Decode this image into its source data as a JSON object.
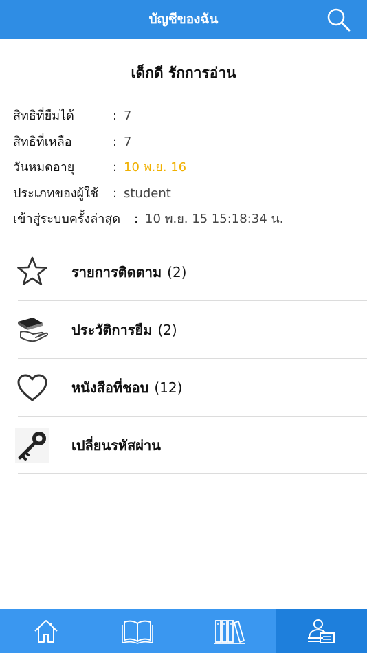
{
  "header": {
    "title": "บัญชีของฉัน",
    "search_icon": "search-icon"
  },
  "user": {
    "name": "เด็กดี รักการอ่าน"
  },
  "info": {
    "rows": [
      {
        "label": "สิทธิที่ยืมได้",
        "colon": ":",
        "value": "7"
      },
      {
        "label": "สิทธิที่เหลือ",
        "colon": ":",
        "value": "7"
      },
      {
        "label": "วันหมดอายุ",
        "colon": ":",
        "value": "10 พ.ย. 16"
      },
      {
        "label": "ประเภทของผู้ใช้",
        "colon": ":",
        "value": "student"
      },
      {
        "label": "เข้าสู่ระบบครั้งล่าสุด",
        "colon": ":",
        "value": "10 พ.ย. 15 15:18:34 น."
      }
    ],
    "expire_color": "#f0b000"
  },
  "menu": {
    "items": [
      {
        "label": "รายการติดตาม",
        "count": "(2)",
        "icon": "star-icon"
      },
      {
        "label": "ประวัติการยืม",
        "count": "(2)",
        "icon": "book-in-hand-icon"
      },
      {
        "label": "หนังสือที่ชอบ",
        "count": "(12)",
        "icon": "heart-icon"
      },
      {
        "label": "เปลี่ยนรหัสผ่าน",
        "count": "",
        "icon": "key-icon"
      }
    ]
  },
  "tabbar": {
    "tabs": [
      {
        "icon": "home-icon",
        "active": false
      },
      {
        "icon": "open-book-icon",
        "active": false
      },
      {
        "icon": "bookshelf-icon",
        "active": false
      },
      {
        "icon": "account-icon",
        "active": true
      }
    ]
  },
  "colors": {
    "primary": "#2f8de4",
    "tabbar": "#3a97f0",
    "tab_active": "#1e7fdc",
    "accent": "#f0b000"
  }
}
